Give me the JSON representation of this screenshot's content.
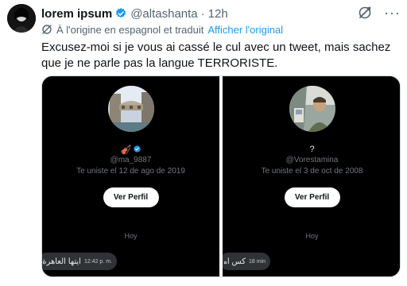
{
  "tweet": {
    "display_name": "lorem ipsum",
    "handle": "@altashanta",
    "separator": "·",
    "time": "12h",
    "more_label": "···",
    "translation_note": "À l'origine en espagnol et traduit",
    "show_original_label": "Afficher l'original",
    "text": "Excusez-moi si je vous ai cassé le cul avec un tweet, mais sachez que je ne parle pas la langue TERRORISTE."
  },
  "media": {
    "left": {
      "name": "🎻",
      "handle": "@ma_9887",
      "joined": "Te uniste el 12 de ago de 2019",
      "button_label": "Ver Perfil",
      "day_label": "Hoy",
      "message_text": "ايتها العاهرة القذرة",
      "message_time": "12:42 p. m."
    },
    "right": {
      "name": "?",
      "handle": "@Vorestamina",
      "joined": "Te uniste el 3 de oct de 2008",
      "button_label": "Ver Perfil",
      "day_label": "Hoy",
      "message_text": "كس امك",
      "message_time": "18 min"
    }
  },
  "colors": {
    "text_primary": "#0f1419",
    "text_secondary": "#536471",
    "accent": "#1d9bf0",
    "dark_panel": "#000000",
    "bubble": "#2f3336"
  },
  "icons": {
    "verified": "verified-badge-icon",
    "grok": "grok-icon",
    "translate": "translate-icon",
    "more": "more-icon"
  }
}
